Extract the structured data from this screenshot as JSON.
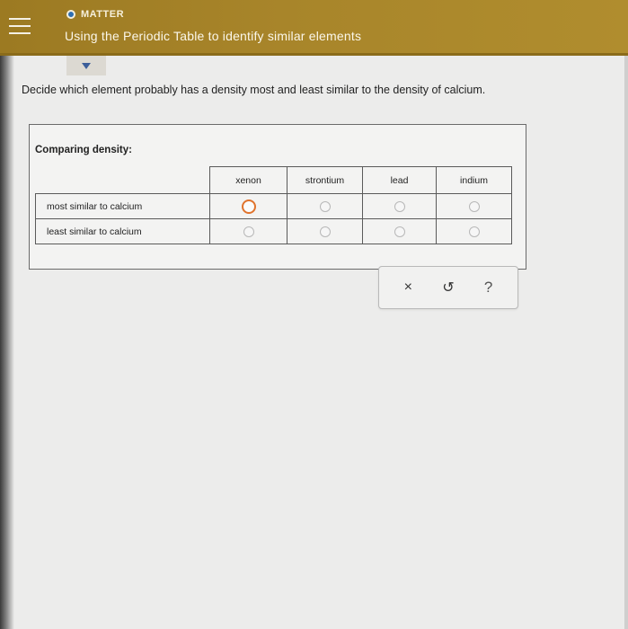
{
  "header": {
    "topic": "MATTER",
    "title": "Using the Periodic Table to identify similar elements"
  },
  "question": "Decide which element probably has a density most and least similar to the density of calcium.",
  "panel": {
    "label": "Comparing density:",
    "columns": [
      "xenon",
      "strontium",
      "lead",
      "indium"
    ],
    "rows": [
      {
        "label": "most similar to calcium",
        "selected": null,
        "focused_column": "xenon"
      },
      {
        "label": "least similar to calcium",
        "selected": null
      }
    ]
  },
  "actions": {
    "clear": "×",
    "undo": "↺",
    "help": "?"
  },
  "colors": {
    "header": "#a8852a",
    "focus_ring": "#e0732c",
    "topic_dot": "#2f6fb1"
  }
}
